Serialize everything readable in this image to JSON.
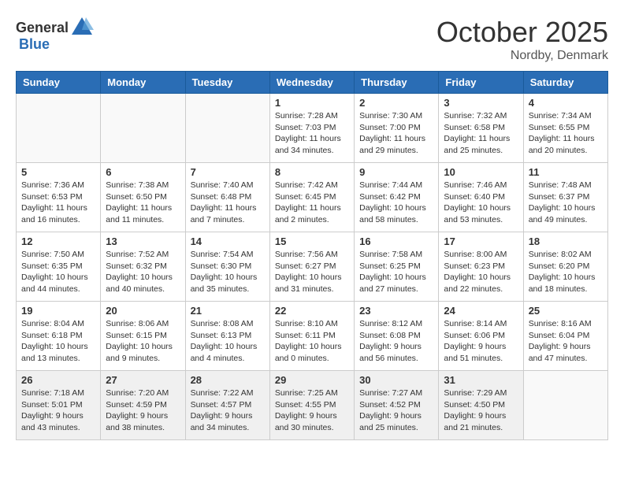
{
  "header": {
    "logo_general": "General",
    "logo_blue": "Blue",
    "month": "October 2025",
    "location": "Nordby, Denmark"
  },
  "weekdays": [
    "Sunday",
    "Monday",
    "Tuesday",
    "Wednesday",
    "Thursday",
    "Friday",
    "Saturday"
  ],
  "weeks": [
    [
      {
        "day": "",
        "text": "",
        "empty": true
      },
      {
        "day": "",
        "text": "",
        "empty": true
      },
      {
        "day": "",
        "text": "",
        "empty": true
      },
      {
        "day": "1",
        "text": "Sunrise: 7:28 AM\nSunset: 7:03 PM\nDaylight: 11 hours\nand 34 minutes."
      },
      {
        "day": "2",
        "text": "Sunrise: 7:30 AM\nSunset: 7:00 PM\nDaylight: 11 hours\nand 29 minutes."
      },
      {
        "day": "3",
        "text": "Sunrise: 7:32 AM\nSunset: 6:58 PM\nDaylight: 11 hours\nand 25 minutes."
      },
      {
        "day": "4",
        "text": "Sunrise: 7:34 AM\nSunset: 6:55 PM\nDaylight: 11 hours\nand 20 minutes."
      }
    ],
    [
      {
        "day": "5",
        "text": "Sunrise: 7:36 AM\nSunset: 6:53 PM\nDaylight: 11 hours\nand 16 minutes."
      },
      {
        "day": "6",
        "text": "Sunrise: 7:38 AM\nSunset: 6:50 PM\nDaylight: 11 hours\nand 11 minutes."
      },
      {
        "day": "7",
        "text": "Sunrise: 7:40 AM\nSunset: 6:48 PM\nDaylight: 11 hours\nand 7 minutes."
      },
      {
        "day": "8",
        "text": "Sunrise: 7:42 AM\nSunset: 6:45 PM\nDaylight: 11 hours\nand 2 minutes."
      },
      {
        "day": "9",
        "text": "Sunrise: 7:44 AM\nSunset: 6:42 PM\nDaylight: 10 hours\nand 58 minutes."
      },
      {
        "day": "10",
        "text": "Sunrise: 7:46 AM\nSunset: 6:40 PM\nDaylight: 10 hours\nand 53 minutes."
      },
      {
        "day": "11",
        "text": "Sunrise: 7:48 AM\nSunset: 6:37 PM\nDaylight: 10 hours\nand 49 minutes."
      }
    ],
    [
      {
        "day": "12",
        "text": "Sunrise: 7:50 AM\nSunset: 6:35 PM\nDaylight: 10 hours\nand 44 minutes."
      },
      {
        "day": "13",
        "text": "Sunrise: 7:52 AM\nSunset: 6:32 PM\nDaylight: 10 hours\nand 40 minutes."
      },
      {
        "day": "14",
        "text": "Sunrise: 7:54 AM\nSunset: 6:30 PM\nDaylight: 10 hours\nand 35 minutes."
      },
      {
        "day": "15",
        "text": "Sunrise: 7:56 AM\nSunset: 6:27 PM\nDaylight: 10 hours\nand 31 minutes."
      },
      {
        "day": "16",
        "text": "Sunrise: 7:58 AM\nSunset: 6:25 PM\nDaylight: 10 hours\nand 27 minutes."
      },
      {
        "day": "17",
        "text": "Sunrise: 8:00 AM\nSunset: 6:23 PM\nDaylight: 10 hours\nand 22 minutes."
      },
      {
        "day": "18",
        "text": "Sunrise: 8:02 AM\nSunset: 6:20 PM\nDaylight: 10 hours\nand 18 minutes."
      }
    ],
    [
      {
        "day": "19",
        "text": "Sunrise: 8:04 AM\nSunset: 6:18 PM\nDaylight: 10 hours\nand 13 minutes."
      },
      {
        "day": "20",
        "text": "Sunrise: 8:06 AM\nSunset: 6:15 PM\nDaylight: 10 hours\nand 9 minutes."
      },
      {
        "day": "21",
        "text": "Sunrise: 8:08 AM\nSunset: 6:13 PM\nDaylight: 10 hours\nand 4 minutes."
      },
      {
        "day": "22",
        "text": "Sunrise: 8:10 AM\nSunset: 6:11 PM\nDaylight: 10 hours\nand 0 minutes."
      },
      {
        "day": "23",
        "text": "Sunrise: 8:12 AM\nSunset: 6:08 PM\nDaylight: 9 hours\nand 56 minutes."
      },
      {
        "day": "24",
        "text": "Sunrise: 8:14 AM\nSunset: 6:06 PM\nDaylight: 9 hours\nand 51 minutes."
      },
      {
        "day": "25",
        "text": "Sunrise: 8:16 AM\nSunset: 6:04 PM\nDaylight: 9 hours\nand 47 minutes."
      }
    ],
    [
      {
        "day": "26",
        "text": "Sunrise: 7:18 AM\nSunset: 5:01 PM\nDaylight: 9 hours\nand 43 minutes."
      },
      {
        "day": "27",
        "text": "Sunrise: 7:20 AM\nSunset: 4:59 PM\nDaylight: 9 hours\nand 38 minutes."
      },
      {
        "day": "28",
        "text": "Sunrise: 7:22 AM\nSunset: 4:57 PM\nDaylight: 9 hours\nand 34 minutes."
      },
      {
        "day": "29",
        "text": "Sunrise: 7:25 AM\nSunset: 4:55 PM\nDaylight: 9 hours\nand 30 minutes."
      },
      {
        "day": "30",
        "text": "Sunrise: 7:27 AM\nSunset: 4:52 PM\nDaylight: 9 hours\nand 25 minutes."
      },
      {
        "day": "31",
        "text": "Sunrise: 7:29 AM\nSunset: 4:50 PM\nDaylight: 9 hours\nand 21 minutes."
      },
      {
        "day": "",
        "text": "",
        "empty": true
      }
    ]
  ]
}
